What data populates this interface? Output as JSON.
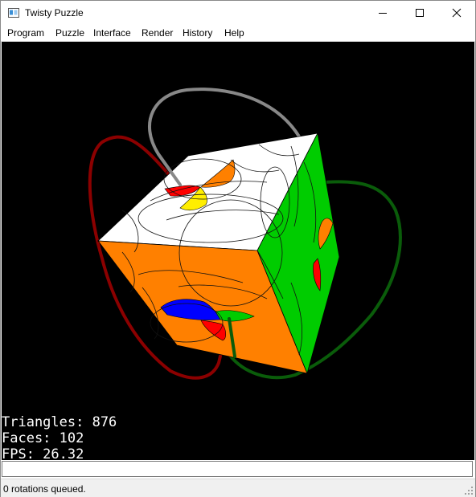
{
  "window": {
    "title": "Twisty Puzzle"
  },
  "menu": {
    "items": [
      "Program",
      "Puzzle",
      "Interface",
      "Render",
      "History",
      "Help"
    ]
  },
  "viewport": {
    "stats": {
      "triangles": "Triangles: 876",
      "faces": "Faces: 102",
      "fps": "FPS: 26.32"
    }
  },
  "command": {
    "value": ""
  },
  "status": {
    "text": "0 rotations queued."
  },
  "colors": {
    "top": "#ffffff",
    "front": "#ff8000",
    "side": "#00cc00",
    "axis_red": "#8b0000",
    "axis_green": "#0a5c0a",
    "axis_gray": "#888888"
  }
}
